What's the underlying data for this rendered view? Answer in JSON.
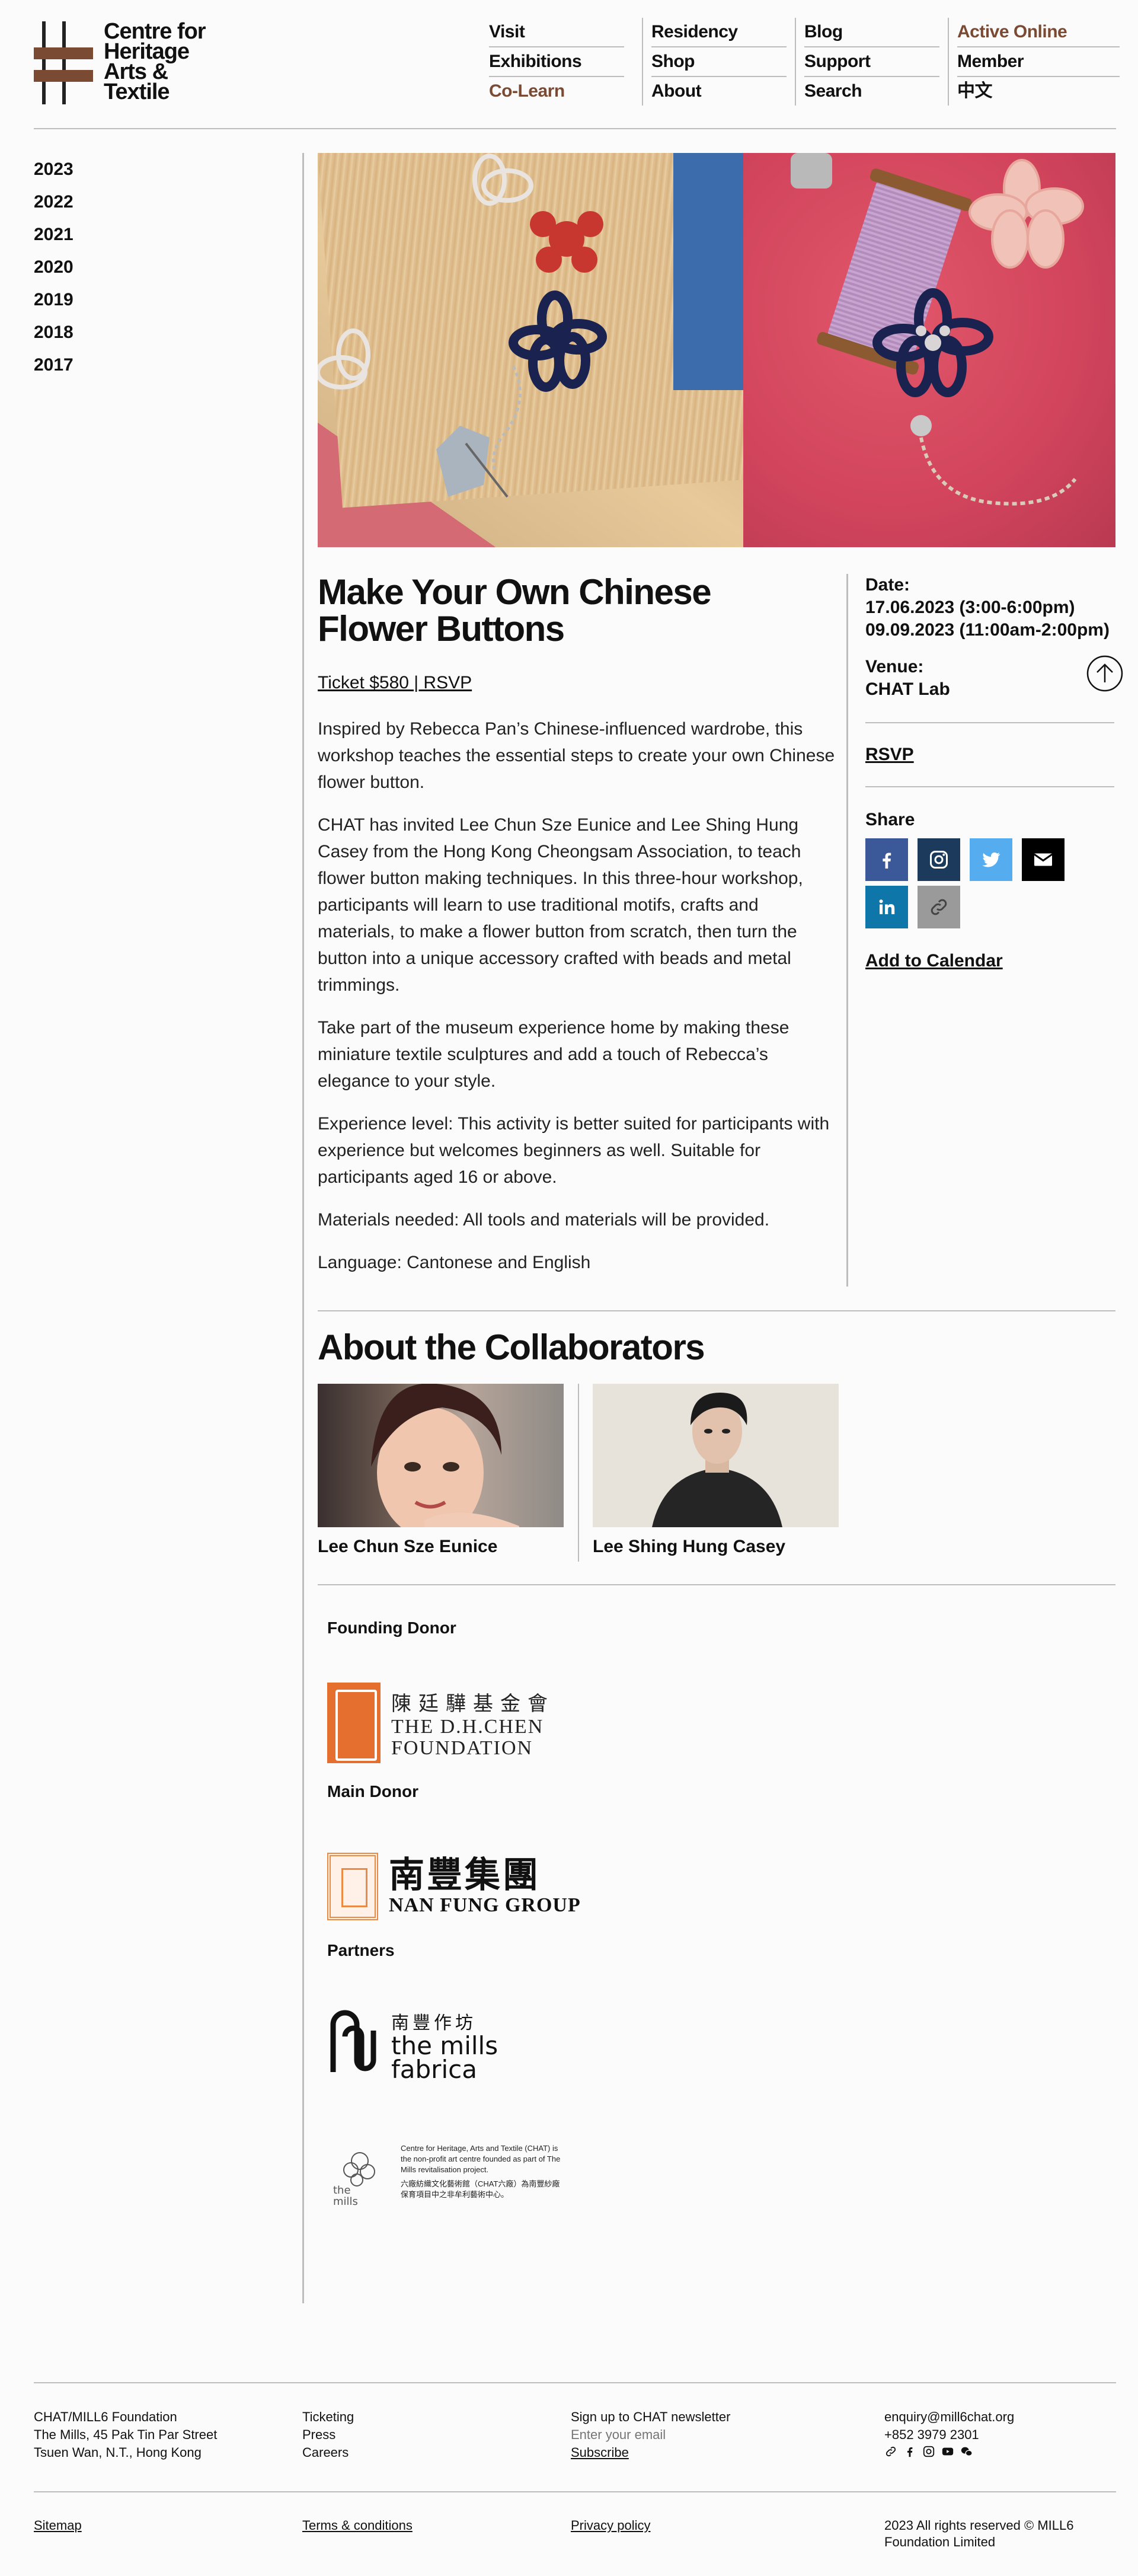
{
  "brand": {
    "logo_lines": [
      "Centre for",
      "Heritage",
      "Arts &",
      "Textile"
    ],
    "accent_color": "#7a4a33"
  },
  "nav": {
    "col1": [
      "Visit",
      "Exhibitions",
      "Co-Learn"
    ],
    "col2": [
      "Residency",
      "Shop",
      "About"
    ],
    "col3": [
      "Blog",
      "Support",
      "Search"
    ],
    "col4": [
      "Active Online",
      "Member",
      "中文"
    ]
  },
  "years": [
    "2023",
    "2022",
    "2021",
    "2020",
    "2019",
    "2018",
    "2017"
  ],
  "event": {
    "title": "Make Your Own Chinese Flower Buttons",
    "ticket": "Ticket $580 | RSVP",
    "paragraphs": [
      "Inspired by Rebecca Pan’s Chinese-influenced wardrobe, this workshop teaches the essential steps to create your own Chinese flower button.",
      "CHAT has invited Lee Chun Sze Eunice and Lee Shing Hung Casey from the Hong Kong Cheongsam Association, to teach flower button making techniques. In this three-hour workshop, participants will learn to use traditional motifs, crafts and materials, to make a flower button from scratch, then turn the button into a unique accessory crafted with beads and metal trimmings.",
      "Take part of the museum experience home by making these miniature textile sculptures and add a touch of Rebecca’s elegance to your style.",
      "Experience level: This activity is better suited for participants with experience but welcomes beginners as well. Suitable for participants aged 16 or above.",
      "Materials needed: All tools and materials will be provided.",
      "Language: Cantonese and English"
    ]
  },
  "info": {
    "date_label": "Date:",
    "date1": "17.06.2023 (3:00-6:00pm)",
    "date2": "09.09.2023 (11:00am-2:00pm)",
    "venue_label": "Venue:",
    "venue": "CHAT Lab",
    "rsvp": "RSVP",
    "share_label": "Share",
    "share_colors": {
      "facebook": "#3b5998",
      "instagram": "#1b3a5c",
      "twitter": "#55acee",
      "email": "#000000",
      "linkedin": "#0e76a8",
      "link": "#9a9a9a"
    },
    "add_to_calendar": "Add to Calendar"
  },
  "collaborators": {
    "title": "About the Collaborators",
    "people": [
      "Lee Chun Sze Eunice",
      "Lee Shing Hung Casey"
    ]
  },
  "donors": {
    "founding_label": "Founding Donor",
    "dh_cn": "陳廷驊基金會",
    "dh_en1": "THE D.H.CHEN",
    "dh_en2": "FOUNDATION",
    "main_label": "Main Donor",
    "nf_cn": "南豐集團",
    "nf_en": "NAN FUNG GROUP",
    "partners_label": "Partners",
    "mills_cn": "南豐作坊",
    "mills_en1": "the mills",
    "mills_en2": "fabrica",
    "chat_en": "Centre for Heritage, Arts and Textile (CHAT) is the non-profit art centre founded as part of The Mills revitalisation project.",
    "chat_cn": "六廠紡織文化藝術館（CHAT六廠）為南豐紗廠保育項目中之非牟利藝術中心。"
  },
  "footer": {
    "address": [
      "CHAT/MILL6 Foundation",
      "The Mills, 45 Pak Tin Par Street",
      "Tsuen Wan, N.T., Hong Kong"
    ],
    "links": [
      "Ticketing",
      "Press",
      "Careers"
    ],
    "newsletter_label": "Sign up to CHAT newsletter",
    "newsletter_placeholder": "Enter your email",
    "subscribe": "Subscribe",
    "email": "enquiry@mill6chat.org",
    "phone": "+852 3979 2301",
    "sitemap": "Sitemap",
    "terms": "Terms & conditions",
    "privacy": "Privacy policy",
    "copyright": "2023 All rights reserved © MILL6 Foundation Limited"
  }
}
